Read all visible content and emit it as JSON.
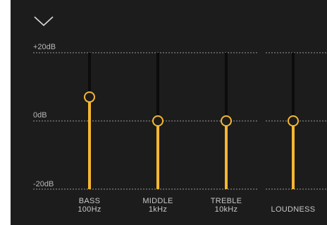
{
  "scale": {
    "max_label": "+20dB",
    "mid_label": "0dB",
    "min_label": "-20dB",
    "max_db": 20,
    "min_db": -20
  },
  "colors": {
    "background": "#1c1c1c",
    "accent": "#f5b731",
    "track": "#0c0c0c",
    "gridline": "#9a9a9a",
    "text": "#c8c8c8"
  },
  "icons": {
    "collapse": "chevron-down-icon"
  },
  "bands": [
    {
      "name": "BASS",
      "freq": "100Hz",
      "value_db": 7
    },
    {
      "name": "MIDDLE",
      "freq": "1kHz",
      "value_db": 0
    },
    {
      "name": "TREBLE",
      "freq": "10kHz",
      "value_db": 0
    },
    {
      "name": "LOUDNESS",
      "freq": "",
      "value_db": 0
    }
  ]
}
